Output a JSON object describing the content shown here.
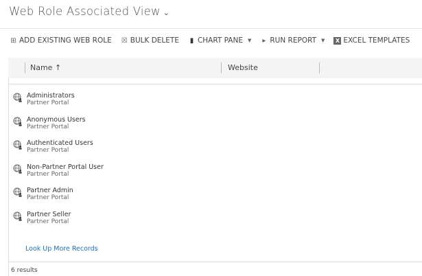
{
  "title": "Web Role Associated View",
  "toolbar": [
    {
      "label": "ADD EXISTING WEB ROLE",
      "icon": "add-record-icon",
      "dropdown": false
    },
    {
      "label": "BULK DELETE",
      "icon": "bulk-delete-icon",
      "dropdown": false
    },
    {
      "label": "CHART PANE",
      "icon": "chart-icon",
      "dropdown": true
    },
    {
      "label": "RUN REPORT",
      "icon": "report-icon",
      "dropdown": true
    },
    {
      "label": "EXCEL TEMPLATES",
      "icon": "excel-icon",
      "dropdown": false
    }
  ],
  "columns": {
    "name": "Name ↑",
    "website": "Website"
  },
  "rows": [
    {
      "name": "Administrators",
      "website": "Partner Portal"
    },
    {
      "name": "Anonymous Users",
      "website": "Partner Portal"
    },
    {
      "name": "Authenticated Users",
      "website": "Partner Portal"
    },
    {
      "name": "Non-Partner Portal User",
      "website": "Partner Portal"
    },
    {
      "name": "Partner Admin",
      "website": "Partner Portal"
    },
    {
      "name": "Partner Seller",
      "website": "Partner Portal"
    }
  ],
  "more_link": "Look Up More Records",
  "footer": "6 results",
  "colors": {
    "link": "#1f6fb5",
    "header_bg": "#f4f4f4"
  }
}
